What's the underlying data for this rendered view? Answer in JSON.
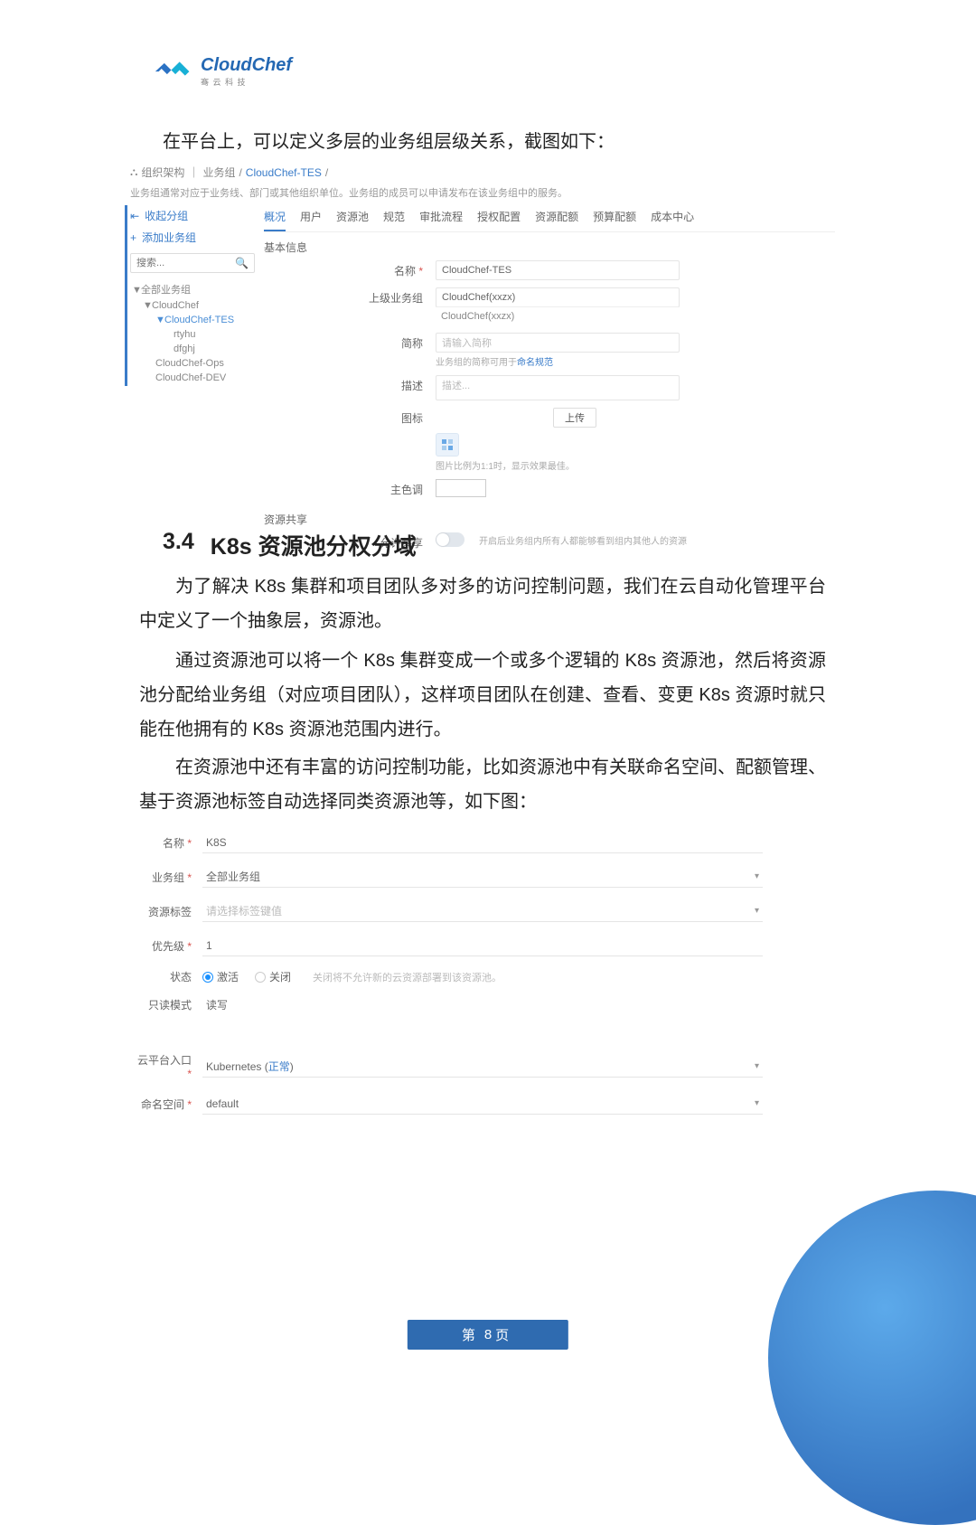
{
  "logo": {
    "brand": "CloudChef",
    "sub": "骞 云 科 技"
  },
  "intro": "在平台上，可以定义多层的业务组层级关系，截图如下：",
  "shot1": {
    "breadcrumb": {
      "root": "组织架构",
      "mid": "业务组",
      "tail": "CloudChef-TES"
    },
    "desc": "业务组通常对应于业务线、部门或其他组织单位。业务组的成员可以申请发布在该业务组中的服务。",
    "sidebar": {
      "collapse": "收起分组",
      "add": "添加业务组",
      "search_placeholder": "搜索...",
      "tree": {
        "all": "全部业务组",
        "n1": "CloudChef",
        "n2": "CloudChef-TES",
        "n3a": "rtyhu",
        "n3b": "dfghj",
        "n1b": "CloudChef-Ops",
        "n1c": "CloudChef-DEV"
      }
    },
    "tabs": [
      "概况",
      "用户",
      "资源池",
      "规范",
      "审批流程",
      "授权配置",
      "资源配额",
      "预算配额",
      "成本中心"
    ],
    "section_basic": "基本信息",
    "form": {
      "name_label": "名称",
      "name_value": "CloudChef-TES",
      "parent_label": "上级业务组",
      "parent_value": "CloudChef(xxzx)",
      "parent_drop": "CloudChef(xxzx)",
      "short_label": "简称",
      "short_placeholder": "请输入简称",
      "short_help_prefix": "业务组的简称可用于",
      "short_help_link": "命名规范",
      "desc_label": "描述",
      "desc_placeholder": "描述...",
      "icon_label": "图标",
      "upload": "上传",
      "icon_help": "图片比例为1:1时，显示效果最佳。",
      "color_label": "主色调"
    },
    "section_share": "资源共享",
    "share": {
      "label": "允许共享",
      "help": "开启后业务组内所有人都能够看到组内其他人的资源"
    }
  },
  "section_heading": {
    "num": "3.4",
    "title": "K8s 资源池分权分域"
  },
  "paragraphs": {
    "p1": "为了解决 K8s 集群和项目团队多对多的访问控制问题，我们在云自动化管理平台中定义了一个抽象层，资源池。",
    "p2": "通过资源池可以将一个 K8s 集群变成一个或多个逻辑的 K8s 资源池，然后将资源池分配给业务组（对应项目团队），这样项目团队在创建、查看、变更 K8s 资源时就只能在他拥有的 K8s 资源池范围内进行。",
    "p3": "在资源池中还有丰富的访问控制功能，比如资源池中有关联命名空间、配额管理、基于资源池标签自动选择同类资源池等，如下图："
  },
  "shot2": {
    "name_label": "名称",
    "name_value": "K8S",
    "biz_label": "业务组",
    "biz_value": "全部业务组",
    "tag_label": "资源标签",
    "tag_placeholder": "请选择标签键值",
    "priority_label": "优先级",
    "priority_value": "1",
    "status_label": "状态",
    "status_active": "激活",
    "status_closed": "关闭",
    "status_help": "关闭将不允许新的云资源部署到该资源池。",
    "readonly_label": "只读模式",
    "readonly_value": "读写",
    "platform_label": "云平台入口",
    "platform_value_prefix": "Kubernetes (",
    "platform_value_link": "正常",
    "platform_value_suffix": ")",
    "ns_label": "命名空间",
    "ns_value": "default"
  },
  "footer": {
    "prefix": "第",
    "num": "8",
    "suffix": "页"
  }
}
